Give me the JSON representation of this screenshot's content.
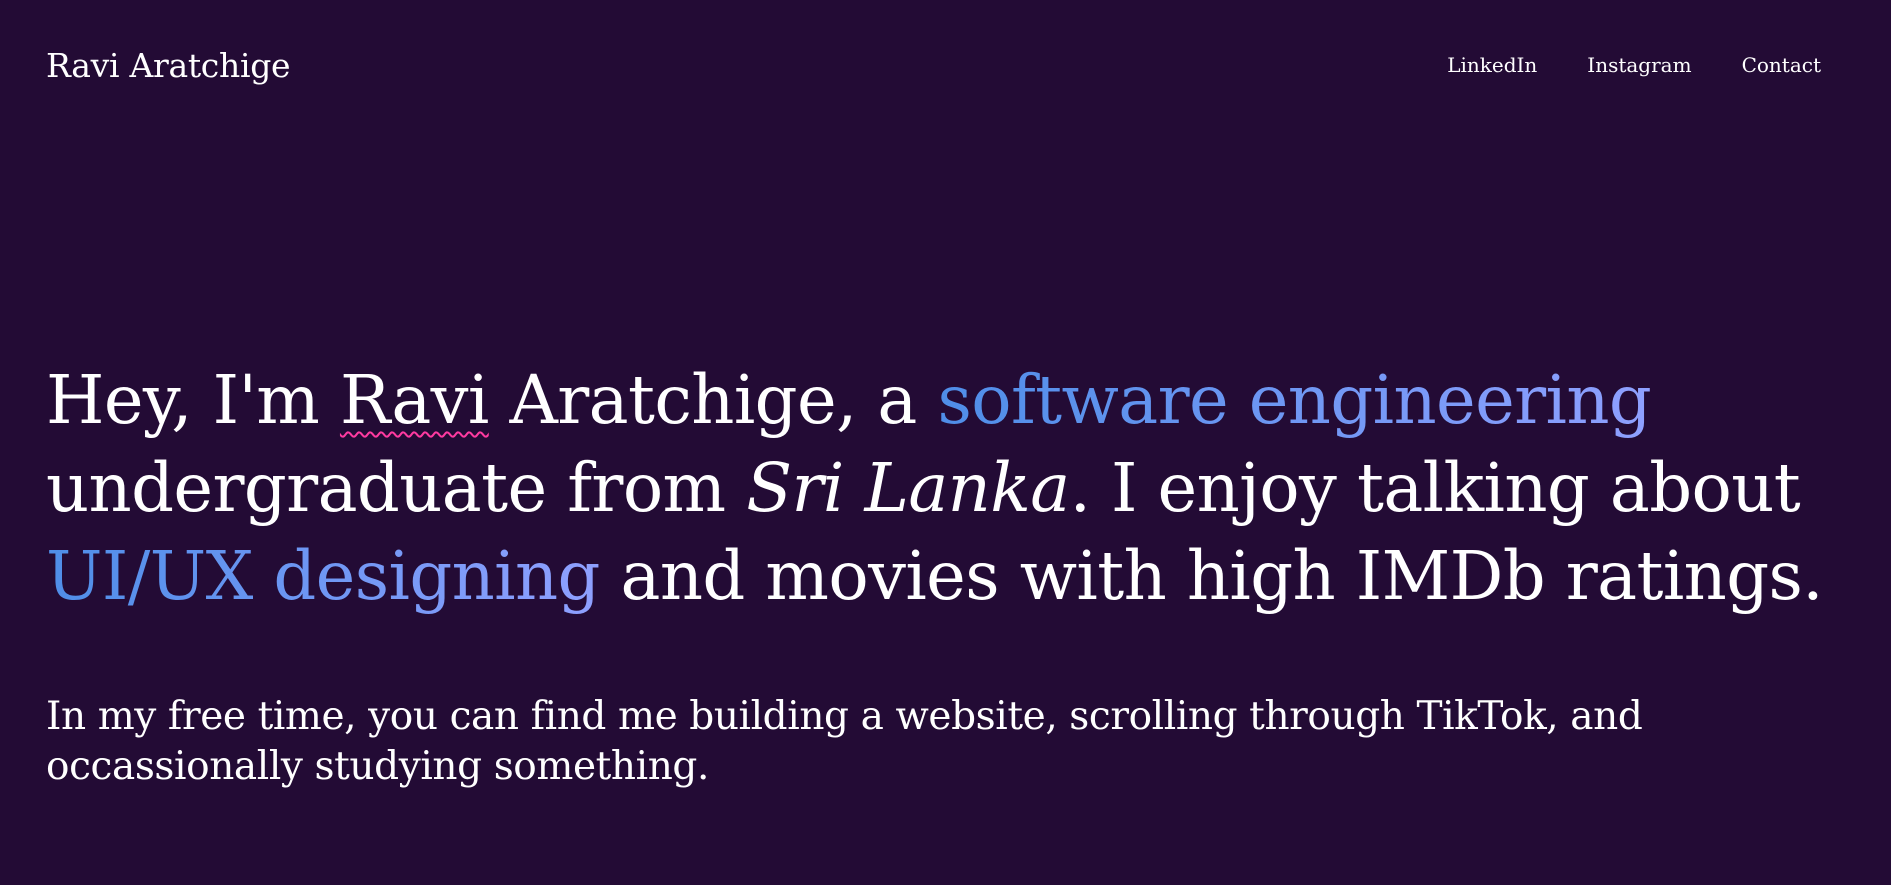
{
  "header": {
    "brand": "Ravi Aratchige",
    "nav": [
      {
        "label": "LinkedIn"
      },
      {
        "label": "Instagram"
      },
      {
        "label": "Contact"
      }
    ]
  },
  "hero": {
    "greeting": "Hey, I'm ",
    "first_name": "Ravi",
    "last_name_suffix": " Aratchige, a ",
    "role": "software engineering",
    "origin_prefix": "undergraduate from ",
    "country": "Sri Lanka",
    "enjoy_text": ". I enjoy talking about",
    "interest": "UI/UX designing",
    "closing": " and movies with high IMDb ratings."
  },
  "intro": {
    "text": "In my free time, you can find me building a website, scrolling through TikTok, and occassionally studying something."
  },
  "colors": {
    "background": "#230b35",
    "text": "#ffffff",
    "accent_start": "#4f8ee8",
    "accent_end": "#8fa0ff",
    "spellcheck_underline": "#ff3aa0"
  }
}
